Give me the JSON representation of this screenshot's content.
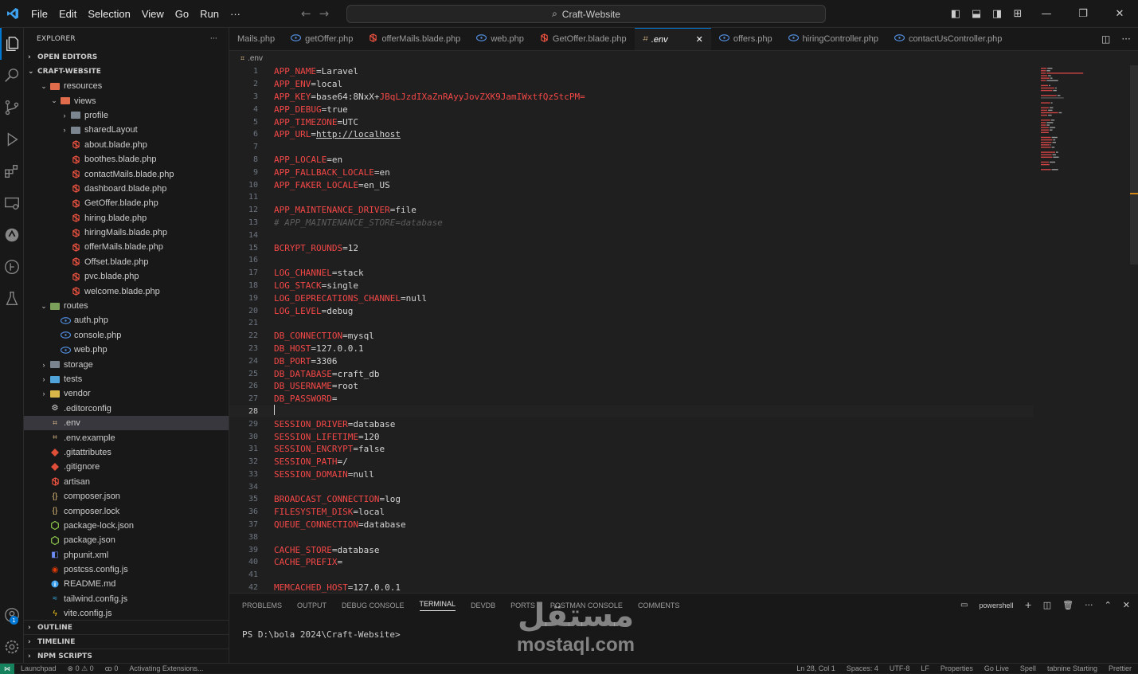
{
  "menu": [
    "File",
    "Edit",
    "Selection",
    "View",
    "Go",
    "Run",
    "···"
  ],
  "command_center": "Craft-Website",
  "explorer": {
    "title": "EXPLORER",
    "open_editors": "OPEN EDITORS",
    "project": "CRAFT-WEBSITE",
    "tree": [
      {
        "label": "resources",
        "depth": 1,
        "type": "folder",
        "cls": "res",
        "open": true
      },
      {
        "label": "views",
        "depth": 2,
        "type": "folder",
        "cls": "views",
        "open": true
      },
      {
        "label": "profile",
        "depth": 3,
        "type": "folder",
        "cls": "",
        "open": false
      },
      {
        "label": "sharedLayout",
        "depth": 3,
        "type": "folder",
        "cls": "",
        "open": false
      },
      {
        "label": "about.blade.php",
        "depth": 3,
        "type": "blade"
      },
      {
        "label": "boothes.blade.php",
        "depth": 3,
        "type": "blade"
      },
      {
        "label": "contactMails.blade.php",
        "depth": 3,
        "type": "blade"
      },
      {
        "label": "dashboard.blade.php",
        "depth": 3,
        "type": "blade"
      },
      {
        "label": "GetOffer.blade.php",
        "depth": 3,
        "type": "blade"
      },
      {
        "label": "hiring.blade.php",
        "depth": 3,
        "type": "blade"
      },
      {
        "label": "hiringMails.blade.php",
        "depth": 3,
        "type": "blade"
      },
      {
        "label": "offerMails.blade.php",
        "depth": 3,
        "type": "blade"
      },
      {
        "label": "Offset.blade.php",
        "depth": 3,
        "type": "blade"
      },
      {
        "label": "pvc.blade.php",
        "depth": 3,
        "type": "blade"
      },
      {
        "label": "welcome.blade.php",
        "depth": 3,
        "type": "blade"
      },
      {
        "label": "routes",
        "depth": 1,
        "type": "folder",
        "cls": "routes",
        "open": true
      },
      {
        "label": "auth.php",
        "depth": 2,
        "type": "php"
      },
      {
        "label": "console.php",
        "depth": 2,
        "type": "php"
      },
      {
        "label": "web.php",
        "depth": 2,
        "type": "php"
      },
      {
        "label": "storage",
        "depth": 1,
        "type": "folder",
        "cls": "storage",
        "open": false
      },
      {
        "label": "tests",
        "depth": 1,
        "type": "folder",
        "cls": "tests",
        "open": false
      },
      {
        "label": "vendor",
        "depth": 1,
        "type": "folder",
        "cls": "vendor",
        "open": false
      },
      {
        "label": ".editorconfig",
        "depth": 1,
        "type": "gear"
      },
      {
        "label": ".env",
        "depth": 1,
        "type": "env",
        "selected": true
      },
      {
        "label": ".env.example",
        "depth": 1,
        "type": "env"
      },
      {
        "label": ".gitattributes",
        "depth": 1,
        "type": "git"
      },
      {
        "label": ".gitignore",
        "depth": 1,
        "type": "git"
      },
      {
        "label": "artisan",
        "depth": 1,
        "type": "blade"
      },
      {
        "label": "composer.json",
        "depth": 1,
        "type": "json"
      },
      {
        "label": "composer.lock",
        "depth": 1,
        "type": "json"
      },
      {
        "label": "package-lock.json",
        "depth": 1,
        "type": "node"
      },
      {
        "label": "package.json",
        "depth": 1,
        "type": "node"
      },
      {
        "label": "phpunit.xml",
        "depth": 1,
        "type": "xml"
      },
      {
        "label": "postcss.config.js",
        "depth": 1,
        "type": "postcss"
      },
      {
        "label": "README.md",
        "depth": 1,
        "type": "info"
      },
      {
        "label": "tailwind.config.js",
        "depth": 1,
        "type": "tailwind"
      },
      {
        "label": "vite.config.js",
        "depth": 1,
        "type": "vite"
      }
    ],
    "outline": "OUTLINE",
    "timeline": "TIMELINE",
    "npm": "NPM SCRIPTS"
  },
  "tabs": [
    {
      "label": "Mails.php",
      "icon": "none"
    },
    {
      "label": "getOffer.php",
      "icon": "php"
    },
    {
      "label": "offerMails.blade.php",
      "icon": "blade"
    },
    {
      "label": "web.php",
      "icon": "php"
    },
    {
      "label": "GetOffer.blade.php",
      "icon": "blade"
    },
    {
      "label": ".env",
      "icon": "env",
      "active": true
    },
    {
      "label": "offers.php",
      "icon": "php"
    },
    {
      "label": "hiringController.php",
      "icon": "php"
    },
    {
      "label": "contactUsController.php",
      "icon": "php"
    }
  ],
  "breadcrumb": ".env",
  "code_lines": [
    {
      "n": "1",
      "k": "APP_NAME",
      "v": "Laravel"
    },
    {
      "n": "2",
      "k": "APP_ENV",
      "v": "local"
    },
    {
      "n": "3",
      "k": "APP_KEY",
      "v": "base64:8NxX+",
      "r": "JBqLJzdIXaZnRAyyJovZXK9JamIWxtfQzStcPM="
    },
    {
      "n": "4",
      "k": "APP_DEBUG",
      "v": "true"
    },
    {
      "n": "5",
      "k": "APP_TIMEZONE",
      "v": "UTC"
    },
    {
      "n": "6",
      "k": "APP_URL",
      "v": "http://localhost",
      "url": true
    },
    {
      "n": "7"
    },
    {
      "n": "8",
      "k": "APP_LOCALE",
      "v": "en"
    },
    {
      "n": "9",
      "k": "APP_FALLBACK_LOCALE",
      "v": "en"
    },
    {
      "n": "10",
      "k": "APP_FAKER_LOCALE",
      "v": "en_US"
    },
    {
      "n": "11"
    },
    {
      "n": "12",
      "k": "APP_MAINTENANCE_DRIVER",
      "v": "file"
    },
    {
      "n": "13",
      "c": "# APP_MAINTENANCE_STORE=database"
    },
    {
      "n": "14"
    },
    {
      "n": "15",
      "k": "BCRYPT_ROUNDS",
      "v": "12"
    },
    {
      "n": "16"
    },
    {
      "n": "17",
      "k": "LOG_CHANNEL",
      "v": "stack"
    },
    {
      "n": "18",
      "k": "LOG_STACK",
      "v": "single"
    },
    {
      "n": "19",
      "k": "LOG_DEPRECATIONS_CHANNEL",
      "v": "null"
    },
    {
      "n": "20",
      "k": "LOG_LEVEL",
      "v": "debug"
    },
    {
      "n": "21"
    },
    {
      "n": "22",
      "k": "DB_CONNECTION",
      "v": "mysql"
    },
    {
      "n": "23",
      "k": "DB_HOST",
      "v": "127.0.0.1"
    },
    {
      "n": "24",
      "k": "DB_PORT",
      "v": "3306"
    },
    {
      "n": "25",
      "k": "DB_DATABASE",
      "v": "craft_db"
    },
    {
      "n": "26",
      "k": "DB_USERNAME",
      "v": "root"
    },
    {
      "n": "27",
      "k": "DB_PASSWORD",
      "v": ""
    },
    {
      "n": "28",
      "cur": true
    },
    {
      "n": "29",
      "k": "SESSION_DRIVER",
      "v": "database"
    },
    {
      "n": "30",
      "k": "SESSION_LIFETIME",
      "v": "120"
    },
    {
      "n": "31",
      "k": "SESSION_ENCRYPT",
      "v": "false"
    },
    {
      "n": "32",
      "k": "SESSION_PATH",
      "v": "/"
    },
    {
      "n": "33",
      "k": "SESSION_DOMAIN",
      "v": "null"
    },
    {
      "n": "34"
    },
    {
      "n": "35",
      "k": "BROADCAST_CONNECTION",
      "v": "log"
    },
    {
      "n": "36",
      "k": "FILESYSTEM_DISK",
      "v": "local"
    },
    {
      "n": "37",
      "k": "QUEUE_CONNECTION",
      "v": "database"
    },
    {
      "n": "38"
    },
    {
      "n": "39",
      "k": "CACHE_STORE",
      "v": "database"
    },
    {
      "n": "40",
      "k": "CACHE_PREFIX",
      "v": ""
    },
    {
      "n": "41"
    },
    {
      "n": "42",
      "k": "MEMCACHED_HOST",
      "v": "127.0.0.1"
    }
  ],
  "panel": {
    "tabs": [
      "PROBLEMS",
      "OUTPUT",
      "DEBUG CONSOLE",
      "TERMINAL",
      "DEVDB",
      "PORTS",
      "POSTMAN CONSOLE",
      "COMMENTS"
    ],
    "active": "TERMINAL",
    "shell": "powershell",
    "prompt": "PS D:\\bola 2024\\Craft-Website>"
  },
  "watermark": {
    "arabic": "مستقل",
    "latin": "mostaql.com"
  },
  "status": {
    "left": [
      "Launchpad",
      "⊗ 0 ⚠ 0",
      "ꝏ 0",
      "Activating Extensions..."
    ],
    "right": [
      "Ln 28, Col 1",
      "Spaces: 4",
      "UTF-8",
      "LF",
      "Properties",
      "Go Live",
      "Spell",
      "tabnine Starting",
      "Prettier"
    ]
  },
  "accounts_badge": "1",
  "colors": {
    "accent": "#0078d4",
    "key": "#f44747",
    "bg": "#1f1f1f",
    "sidebar": "#181818"
  }
}
